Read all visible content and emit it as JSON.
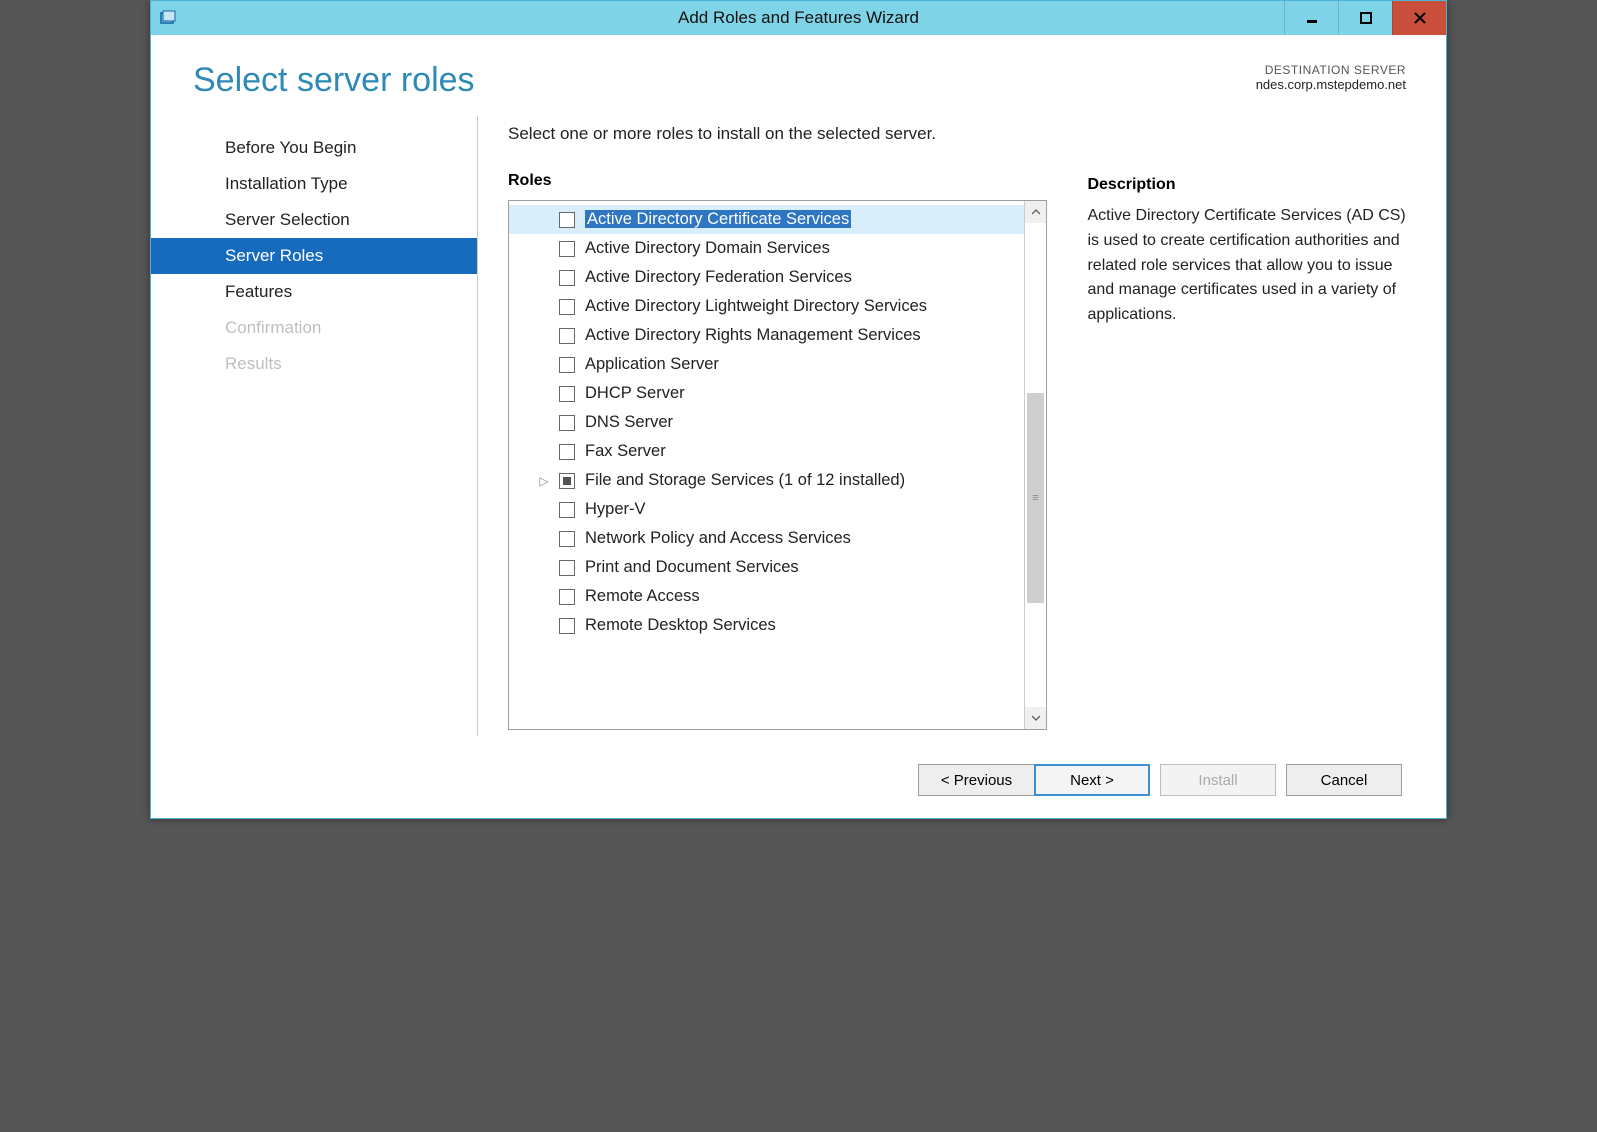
{
  "window": {
    "title": "Add Roles and Features Wizard"
  },
  "heading": "Select server roles",
  "destination": {
    "label": "DESTINATION SERVER",
    "server": "ndes.corp.mstepdemo.net"
  },
  "nav": {
    "items": [
      {
        "label": "Before You Begin",
        "state": "normal"
      },
      {
        "label": "Installation Type",
        "state": "normal"
      },
      {
        "label": "Server Selection",
        "state": "normal"
      },
      {
        "label": "Server Roles",
        "state": "active"
      },
      {
        "label": "Features",
        "state": "normal"
      },
      {
        "label": "Confirmation",
        "state": "disabled"
      },
      {
        "label": "Results",
        "state": "disabled"
      }
    ]
  },
  "instruction": "Select one or more roles to install on the selected server.",
  "roles_header": "Roles",
  "description_header": "Description",
  "description_text": "Active Directory Certificate Services (AD CS) is used to create certification authorities and related role services that allow you to issue and manage certificates used in a variety of applications.",
  "roles": [
    {
      "label": "Active Directory Certificate Services",
      "checked": false,
      "selected": true,
      "expandable": false
    },
    {
      "label": "Active Directory Domain Services",
      "checked": false
    },
    {
      "label": "Active Directory Federation Services",
      "checked": false
    },
    {
      "label": "Active Directory Lightweight Directory Services",
      "checked": false
    },
    {
      "label": "Active Directory Rights Management Services",
      "checked": false
    },
    {
      "label": "Application Server",
      "checked": false
    },
    {
      "label": "DHCP Server",
      "checked": false
    },
    {
      "label": "DNS Server",
      "checked": false
    },
    {
      "label": "Fax Server",
      "checked": false
    },
    {
      "label": "File and Storage Services (1 of 12 installed)",
      "checked": "indeterminate",
      "expandable": true
    },
    {
      "label": "Hyper-V",
      "checked": false
    },
    {
      "label": "Network Policy and Access Services",
      "checked": false
    },
    {
      "label": "Print and Document Services",
      "checked": false
    },
    {
      "label": "Remote Access",
      "checked": false
    },
    {
      "label": "Remote Desktop Services",
      "checked": false
    }
  ],
  "buttons": {
    "previous": "< Previous",
    "next": "Next >",
    "install": "Install",
    "cancel": "Cancel"
  }
}
